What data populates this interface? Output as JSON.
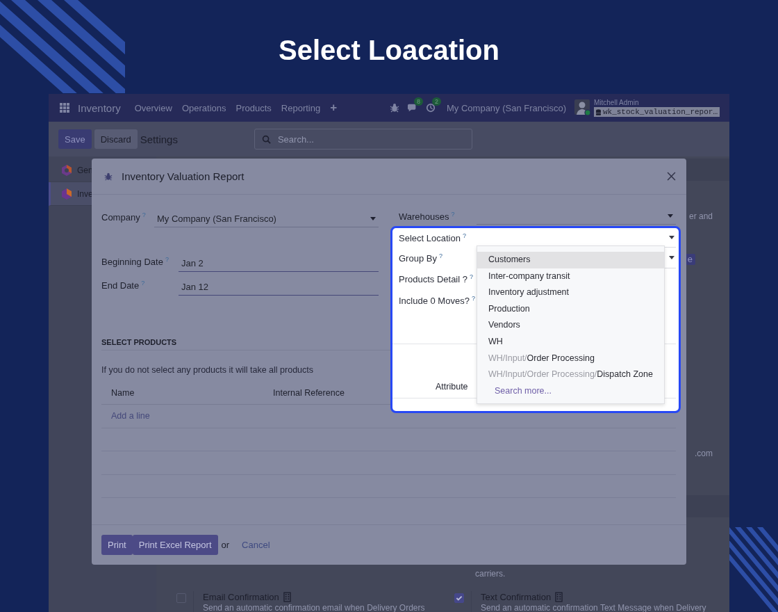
{
  "heading": "Select Loacation",
  "navbar": {
    "app": "Inventory",
    "menus": [
      "Overview",
      "Operations",
      "Products",
      "Reporting"
    ],
    "add": "+",
    "messages_count": "8",
    "activities_count": "2",
    "company": "My Company (San Francisco)",
    "user": "Mitchell Admin",
    "database": "wk_stock_valuation_repor…"
  },
  "control_panel": {
    "buttons": [
      {
        "label": "Save",
        "kind": "primary"
      },
      {
        "label": "Discard",
        "kind": "secondary"
      }
    ],
    "breadcrumb": "Settings",
    "search": {
      "placeholder": "Search..."
    }
  },
  "sidebar": {
    "items": [
      {
        "label": "Gen",
        "selected": false
      },
      {
        "label": "Inve",
        "selected": true
      }
    ]
  },
  "settings": {
    "edge_items": [
      {
        "kind": "text",
        "text": "er and"
      },
      {
        "kind": "button",
        "text": "e"
      },
      {
        "kind": "text",
        "text": ".com"
      }
    ],
    "note": "carriers.",
    "options": [
      {
        "title": "Email Confirmation",
        "description": "Send an automatic confirmation email when Delivery Orders",
        "checked": false
      },
      {
        "title": "Text Confirmation",
        "description": "Send an automatic confirmation Text Message when Delivery",
        "checked": true
      }
    ]
  },
  "dialog": {
    "title": "Inventory Valuation Report",
    "left_fields": [
      {
        "label": "Company",
        "help": "?",
        "value": "My Company (San Francisco)",
        "kind": "select"
      },
      {
        "label": "Beginning Date",
        "help": "?",
        "value": "Jan 2",
        "kind": "date"
      },
      {
        "label": "End Date",
        "help": "?",
        "value": "Jan 12",
        "kind": "date"
      }
    ],
    "right_fields": [
      {
        "label": "Warehouses",
        "help": "?",
        "kind": "select",
        "highlighted": false
      },
      {
        "label": "Select Location",
        "help": "?",
        "kind": "select",
        "highlighted": true
      },
      {
        "label": "Group By",
        "help": "?",
        "kind": "select",
        "highlighted": true
      },
      {
        "label": "Products Detail ?",
        "help": "?",
        "kind": "checkbox",
        "highlighted": true
      },
      {
        "label": "Include 0 Moves?",
        "help": "?",
        "kind": "checkbox",
        "highlighted": true
      }
    ],
    "section": "SELECT PRODUCTS",
    "hint": "If you do not select any products it will take all products",
    "columns": [
      "Name",
      "Internal Reference",
      "Attribute"
    ],
    "add_line": "Add a line",
    "buttons": [
      {
        "label": "Print"
      },
      {
        "label": "Print Excel Report"
      }
    ],
    "or": "or",
    "cancel": "Cancel"
  },
  "dropdown": {
    "options": [
      {
        "name": "Customers",
        "selected": true
      },
      {
        "name": "Inter-company transit",
        "selected": false
      },
      {
        "name": "Inventory adjustment",
        "selected": false
      },
      {
        "name": "Production",
        "selected": false
      },
      {
        "name": "Vendors",
        "selected": false
      },
      {
        "name": "WH",
        "selected": false
      },
      {
        "prefix": "WH/Input/",
        "name": "Order Processing",
        "selected": false
      },
      {
        "prefix": "WH/Input/Order Processing/",
        "name": "Dispatch Zone",
        "selected": false
      }
    ],
    "search_more": "Search more..."
  }
}
